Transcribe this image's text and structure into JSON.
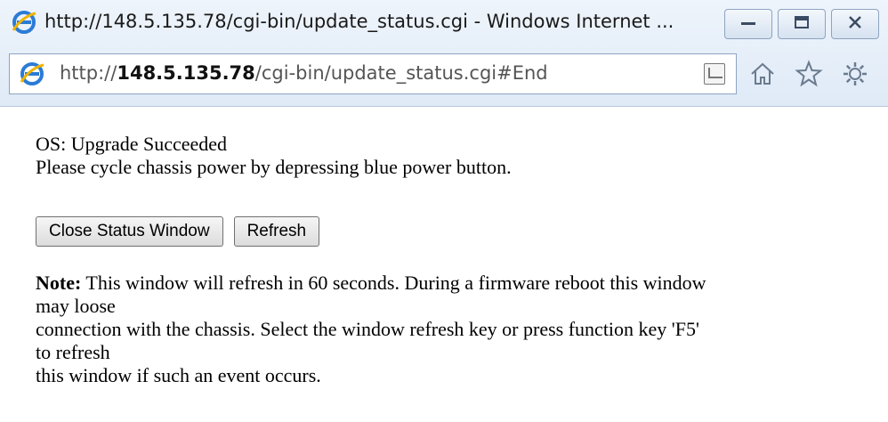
{
  "window": {
    "title": "http://148.5.135.78/cgi-bin/update_status.cgi - Windows Internet ...",
    "buttons": {
      "minimize_icon": "minimize-icon",
      "maximize_icon": "restore-icon",
      "close_icon": "close-icon"
    }
  },
  "address_bar": {
    "prefix": "http://",
    "host": "148.5.135.78",
    "path": "/cgi-bin/update_status.cgi#End"
  },
  "toolbar_icons": [
    "home-icon",
    "star-icon",
    "gear-icon"
  ],
  "content": {
    "status_line1": "OS: Upgrade Succeeded",
    "status_line2": "Please cycle chassis power by depressing blue power button.",
    "buttons": {
      "close_label": "Close Status Window",
      "refresh_label": "Refresh"
    },
    "note": {
      "label": "Note:",
      "line1": " This window will refresh in 60 seconds. During a firmware reboot this window",
      "line2": "may loose",
      "line3": "connection with the chassis. Select the window refresh key or press function key 'F5'",
      "line4": "to refresh",
      "line5": "this window if such an event occurs."
    }
  },
  "colors": {
    "chrome_top": "#eef4fb",
    "chrome_bottom": "#dfeaf7",
    "frame_border": "#8ea4c1"
  }
}
